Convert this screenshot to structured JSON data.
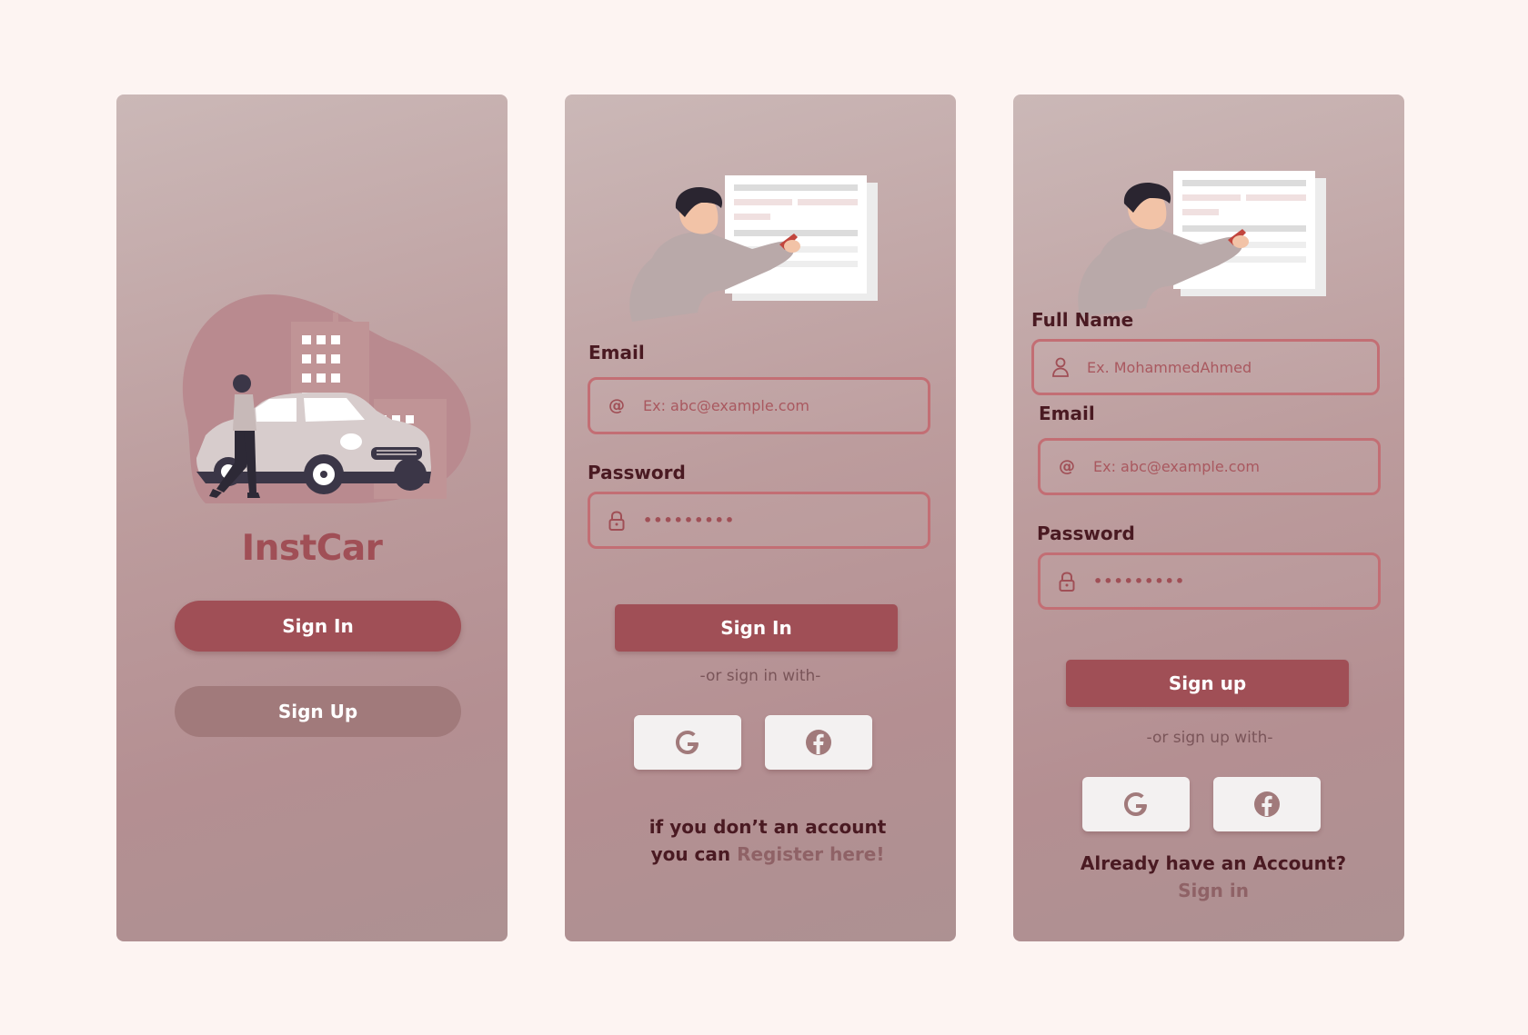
{
  "splash": {
    "brand": "InstCar",
    "sign_in_label": "Sign In",
    "sign_up_label": "Sign Up"
  },
  "signin": {
    "email_label": "Email",
    "email_placeholder": "Ex: abc@example.com",
    "password_label": "Password",
    "password_mask": "•••••••••",
    "submit_label": "Sign In",
    "alt_text": "-or sign in with-",
    "footer_line1": "if you don’t an account",
    "footer_line2_prefix": "you can ",
    "footer_link": "Register here!"
  },
  "signup": {
    "fullname_label": "Full Name",
    "fullname_placeholder": "Ex. MohammedAhmed",
    "email_label": "Email",
    "email_placeholder": "Ex: abc@example.com",
    "password_label": "Password",
    "password_mask": "•••••••••",
    "submit_label": "Sign up",
    "alt_text": "-or sign up with-",
    "footer_line1": "Already have an Account?",
    "footer_link": "Sign in"
  },
  "icons": {
    "at": "@",
    "user": "user-icon",
    "lock": "lock-icon",
    "google": "google-icon",
    "facebook": "facebook-icon"
  },
  "colors": {
    "background": "#fdf4f2",
    "primary": "#a04f56",
    "secondary": "#a17a7b",
    "label": "#4a1a22",
    "field_border": "#c36e74"
  }
}
